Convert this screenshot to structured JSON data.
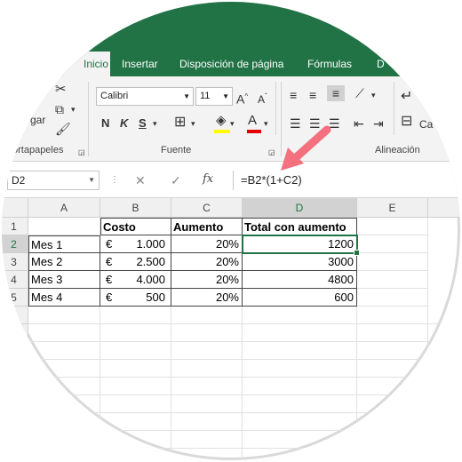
{
  "tabs": [
    "Inicio",
    "Insertar",
    "Disposición de página",
    "Fórmulas",
    "D"
  ],
  "ribbon": {
    "clipboard_label": "ortapapeles",
    "paste_label": "gar",
    "font_label": "Fuente",
    "align_label": "Alineación",
    "font_name": "Calibri",
    "font_size": "11",
    "bold": "N",
    "italic": "K",
    "underline": "S",
    "grow_font": "A",
    "shrink_font": "A",
    "font_color": "A",
    "partial_right": "Ca"
  },
  "formula_bar": {
    "name_box": "D2",
    "fx": "fx",
    "formula": "=B2*(1+C2)"
  },
  "columns": [
    "A",
    "B",
    "C",
    "D",
    "E"
  ],
  "rows": [
    "1",
    "2",
    "3",
    "4",
    "5"
  ],
  "table": {
    "headers": [
      "Costo",
      "Aumento",
      "Total con aumento"
    ],
    "currency": "€",
    "data": [
      {
        "label": "Mes 1",
        "cost": "1.000",
        "inc": "20%",
        "total": "1200"
      },
      {
        "label": "Mes 2",
        "cost": "2.500",
        "inc": "20%",
        "total": "3000"
      },
      {
        "label": "Mes 3",
        "cost": "4.000",
        "inc": "20%",
        "total": "4800"
      },
      {
        "label": "Mes 4",
        "cost": "500",
        "inc": "20%",
        "total": "600"
      }
    ]
  },
  "colors": {
    "excel_green": "#217346",
    "arrow": "#f4707e"
  }
}
